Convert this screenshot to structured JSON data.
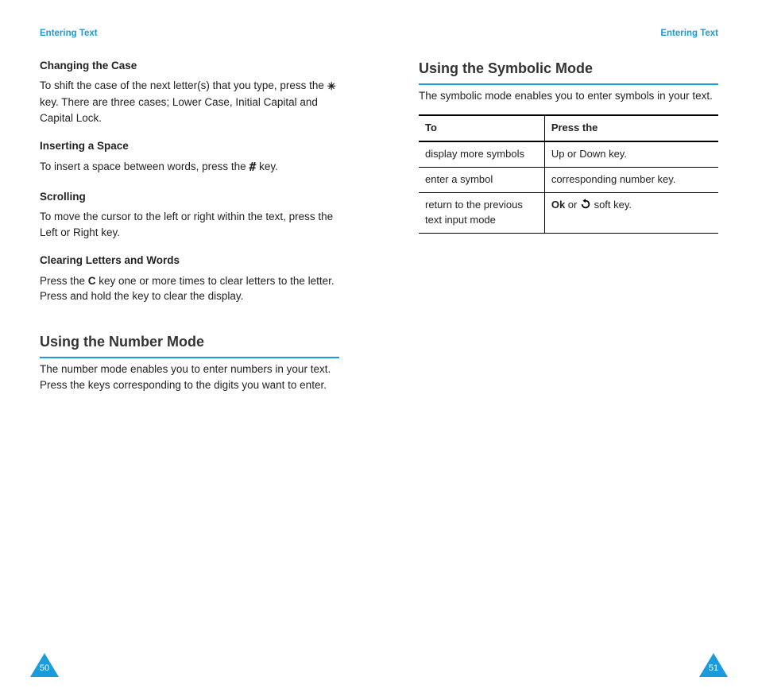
{
  "header": {
    "left": "Entering Text",
    "right": "Entering Text"
  },
  "left_page": {
    "sub1_title": "Changing the Case",
    "sub1_text_a": "To shift the case of the next letter(s) that you type, press the ",
    "sub1_text_b": " key. There are three cases; Lower Case, Initial Capital and Capital Lock.",
    "sub2_title": "Inserting a Space",
    "sub2_text_a": "To insert a space between words, press the ",
    "sub2_text_b": " key.",
    "sub3_title": "Scrolling",
    "sub3_text": "To move the cursor to the left or right within the text, press the Left or Right key.",
    "sub4_title": "Clearing Letters and Words",
    "sub4_text_a": "Press the ",
    "sub4_key": "C",
    "sub4_text_b": " key one or more times to clear letters to the letter. Press and hold the key to clear the display.",
    "section_title": "Using the Number Mode",
    "section_text": "The number mode enables you to enter numbers in your text. Press the keys corresponding to the digits you want to enter.",
    "page_num": "50"
  },
  "right_page": {
    "section_title": "Using the Symbolic Mode",
    "section_text": "The symbolic mode enables you to enter symbols in your text.",
    "table": {
      "h1": "To",
      "h2": "Press the",
      "r1c1": "display more symbols",
      "r1c2": "Up or Down key.",
      "r2c1": "enter a symbol",
      "r2c2": "corresponding number key.",
      "r3c1": "return to the previous text input mode",
      "r3c2_a": "Ok",
      "r3c2_b": " or ",
      "r3c2_c": " soft key."
    },
    "page_num": "51"
  }
}
